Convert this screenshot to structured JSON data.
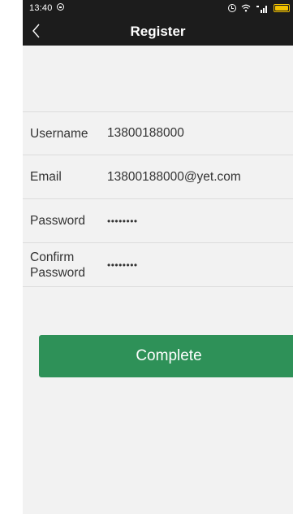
{
  "status_bar": {
    "time": "13:40",
    "icons": [
      "app-notification-icon",
      "alarm-icon",
      "wifi-icon",
      "signal-icon",
      "battery-icon"
    ],
    "battery_color": "#f2c200"
  },
  "nav": {
    "title": "Register",
    "back_icon": "chevron-left-icon"
  },
  "form": {
    "rows": [
      {
        "label": "Username",
        "value": "13800188000"
      },
      {
        "label": "Email",
        "value": "13800188000@yet.com"
      },
      {
        "label": "Password",
        "value": "••••••••"
      },
      {
        "label": "Confirm\nPassword",
        "value": "••••••••"
      }
    ]
  },
  "complete_button": {
    "label": "Complete",
    "color": "#2e9158"
  },
  "colors": {
    "bar_background": "#1c1c1c",
    "screen_background": "#f2f2f2",
    "accent": "#2e9158"
  }
}
